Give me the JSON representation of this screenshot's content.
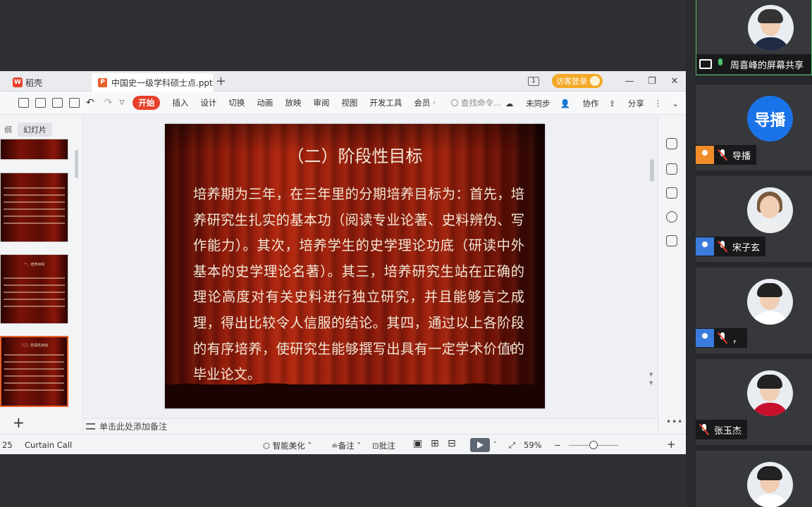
{
  "wps": {
    "tabs": {
      "home": "稻壳",
      "doc": "中国史一级学科硕士点.ppt",
      "add": "+"
    },
    "window": {
      "badge": "1",
      "login": "访客登录",
      "minimize": "—",
      "restore": "❐",
      "close": "✕"
    },
    "ribbon": {
      "start": "开始",
      "menu": [
        "插入",
        "设计",
        "切换",
        "动画",
        "放映",
        "审阅",
        "视图",
        "开发工具",
        "会员"
      ],
      "search_placeholder": "查找命令...",
      "sync": "未同步",
      "collab": "协作",
      "share": "分享"
    },
    "left_pane": {
      "tab_outline": "纲",
      "tab_slides": "幻灯片",
      "thumb3_title": "一、培养目标",
      "thumb4_title": "（二）阶段性目标"
    },
    "slide": {
      "title": "（二）阶段性目标",
      "body": "培养期为三年，在三年里的分期培养目标为：首先，培养研究生扎实的基本功（阅读专业论著、史料辨伪、写作能力）。其次，培养学生的史学理论功底（研读中外基本的史学理论名著）。其三，培养研究生站在正确的理论高度对有关史料进行独立研究，并且能够言之成理，得出比较令人信服的结论。其四，通过以上各阶段的有序培养，使研究生能够撰写出具有一定学术价值的毕业论文。"
    },
    "notes_placeholder": "单击此处添加备注",
    "status": {
      "slide_no": "25",
      "theme": "Curtain Call",
      "beautify": "智能美化",
      "notes": "备注",
      "comment": "批注",
      "zoom": "59%"
    }
  },
  "participants": [
    {
      "name": "周喜峰的屏幕共享",
      "role": "sharer"
    },
    {
      "name": "导播",
      "avatar_text": "导播"
    },
    {
      "name": "宋子玄"
    },
    {
      "name": "，"
    },
    {
      "name": "张玉杰"
    },
    {
      "name": ""
    }
  ],
  "colors": {
    "wps_red": "#e8412b",
    "slide_bg": "#8c1a0b",
    "active_border": "#4fc36b",
    "avatar_blue": "#1a73e8"
  }
}
